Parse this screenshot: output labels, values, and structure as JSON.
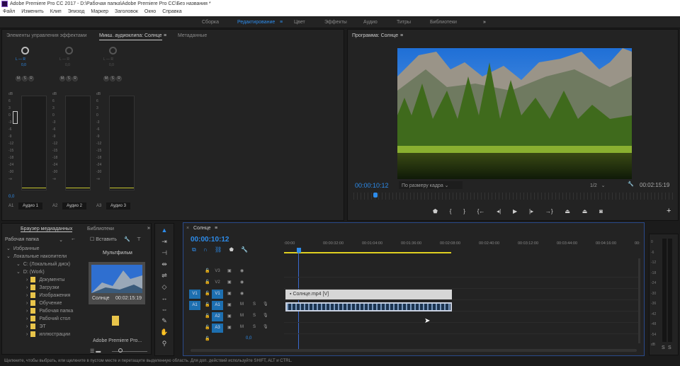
{
  "window": {
    "title": "Adobe Premiere Pro CC 2017 - D:\\Рабочая папка\\Adobe Premiere Pro CC\\Без названия *"
  },
  "menu": [
    "Файл",
    "Изменить",
    "Клип",
    "Эпизод",
    "Маркер",
    "Заголовок",
    "Окно",
    "Справка"
  ],
  "workspaces": {
    "items": [
      "Сборка",
      "Редактирование",
      "Цвет",
      "Эффекты",
      "Аудио",
      "Титры",
      "Библиотеки"
    ],
    "active": "Редактирование",
    "more": "»"
  },
  "left_panel": {
    "tabs": [
      "Элементы управления эффектами",
      "Микш. аудиоклипа: Солнце",
      "Метаданные"
    ],
    "active": "Микш. аудиоклипа: Солнце"
  },
  "mixer": {
    "channels": [
      {
        "id": "A1",
        "name": "Аудио 1",
        "pan": "0,0",
        "lr": "L — R"
      },
      {
        "id": "A2",
        "name": "Аудио 2",
        "pan": "0,0",
        "lr": "L — R"
      },
      {
        "id": "A3",
        "name": "Аудио 3",
        "pan": "0,0",
        "lr": "L — R"
      }
    ],
    "scale": [
      "dB",
      "6",
      "3",
      "0",
      "-3",
      "-6",
      "-9",
      "-12",
      "-15",
      "-18",
      "-24",
      "-30",
      "-∞"
    ],
    "msr": [
      "M",
      "S",
      "R"
    ],
    "volume": "0,0"
  },
  "program": {
    "title": "Программа: Солнце",
    "timecode": "00:00:10:12",
    "fit": "По размеру кадра",
    "resolution": "1/2",
    "duration": "00:02:15:19",
    "playhead_fraction": 0.077,
    "controls": [
      "marker",
      "mark-in",
      "mark-out",
      "go-to-in",
      "step-back",
      "play",
      "step-forward",
      "go-to-out",
      "lift",
      "extract",
      "export-frame"
    ],
    "control_glyphs": [
      "⬟",
      "{",
      "}",
      "{←",
      "◂|",
      "▶",
      "|▸",
      "→}",
      "⏏",
      "⏏",
      "◙"
    ],
    "add": "+"
  },
  "media_browser": {
    "tabs": [
      "Браузер медиаданных",
      "Библиотеки"
    ],
    "location": "Рабочая папка",
    "insert_label": "Вставить",
    "tree": [
      {
        "label": "Избранные",
        "level": 0
      },
      {
        "label": "Локальные накопители",
        "level": 0
      },
      {
        "label": "C: (Локальный диск)",
        "level": 1
      },
      {
        "label": "D: (Work)",
        "level": 1
      },
      {
        "label": "Документы",
        "level": 2
      },
      {
        "label": "Загрузки",
        "level": 2
      },
      {
        "label": "Изображения",
        "level": 2
      },
      {
        "label": "Обучение",
        "level": 2
      },
      {
        "label": "Рабочая папка",
        "level": 2
      },
      {
        "label": "Рабочий стол",
        "level": 2
      },
      {
        "label": "ЭТ",
        "level": 2
      },
      {
        "label": "иллюстрации",
        "level": 2
      }
    ],
    "folder_title": "Мультфильм",
    "clip_name": "Солнце",
    "clip_duration": "00:02:15:19",
    "folder2": "Adobe Premiere Pro..."
  },
  "timeline": {
    "title": "Солнце",
    "timecode": "00:00:10:12",
    "ruler": [
      ":00:00",
      "00:00:32:00",
      "00:01:04:00",
      "00:01:36:00",
      "00:02:08:00",
      "00:02:40:00",
      "00:03:12:00",
      "00:03:44:00",
      "00:04:16:00",
      "00:"
    ],
    "tracks": [
      {
        "src": "",
        "id": "V3"
      },
      {
        "src": "",
        "id": "V2"
      },
      {
        "src": "V1",
        "id": "V1"
      },
      {
        "src": "A1",
        "id": "A1"
      },
      {
        "src": "",
        "id": "A2"
      },
      {
        "src": "",
        "id": "A3"
      }
    ],
    "video_clip": "Солнце.mp4 [V]",
    "master": "0,0",
    "audio_ms": [
      "M",
      "S"
    ]
  },
  "meters": {
    "scale": [
      "0",
      "-6",
      "-12",
      "-18",
      "-24",
      "-30",
      "-36",
      "-42",
      "-48",
      "-54",
      "dB"
    ],
    "bottom": [
      "S",
      "S"
    ]
  },
  "status": "Щелкните, чтобы выбрать, или щелкните в пустом месте и перетащите выделенную область. Для доп. действий используйте SHIFT, ALT и CTRL.",
  "colors": {
    "accent": "#2d8ceb",
    "panel": "#232323",
    "work_area": "#e0d020"
  }
}
